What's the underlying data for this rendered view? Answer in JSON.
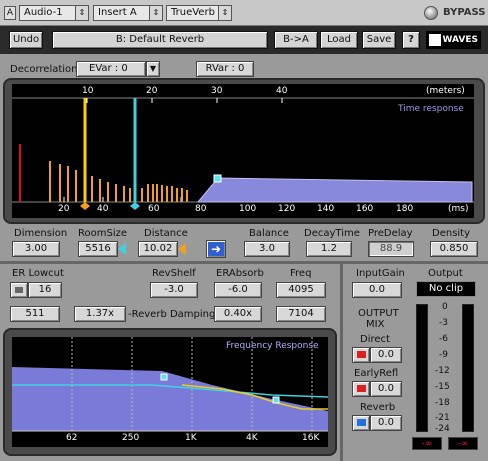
{
  "host": {
    "track": "Audio-1",
    "insert": "Insert A",
    "plugin": "TrueVerb",
    "track_button_letter": "A",
    "bypass_label": "BYPASS"
  },
  "toolbar": {
    "undo": "Undo",
    "preset": "B: Default Reverb",
    "ab": "B->A",
    "load": "Load",
    "save": "Save",
    "help": "?",
    "logo": "WAVES"
  },
  "decorrelation": {
    "label": "Decorrelation",
    "evar": "EVar : 0",
    "rvar": "RVar : 0"
  },
  "time_display": {
    "title": "Time response",
    "top_unit": "(meters)",
    "top_ticks": [
      "10",
      "20",
      "30",
      "40"
    ],
    "bottom_unit": "(ms)",
    "bottom_ticks": [
      "20",
      "40",
      "60",
      "80",
      "100",
      "120",
      "140",
      "160",
      "180"
    ],
    "colors": {
      "direct": "#e01010",
      "early": "#f0a020",
      "cursor": "#ffd000",
      "room": "#40d0e0",
      "tail": "#8888dd"
    }
  },
  "room_params": [
    {
      "label": "Dimension",
      "value": "3.00"
    },
    {
      "label": "RoomSize",
      "value": "5516"
    },
    {
      "label": "Distance",
      "value": "10.02"
    },
    {
      "label": "Balance",
      "value": "3.0"
    },
    {
      "label": "DecayTime",
      "value": "1.2"
    },
    {
      "label": "PreDelay",
      "value": "88.9"
    },
    {
      "label": "Density",
      "value": "0.850"
    }
  ],
  "eq": {
    "er_lowcut_label": "ER Lowcut",
    "er_lowcut_value": "16",
    "revshelf_label": "RevShelf",
    "revshelf_value": "-3.0",
    "erabsorb_label": "ERAbsorb",
    "erabsorb_value": "-6.0",
    "freq_label": "Freq",
    "freq_value": "4095",
    "low_value": "511",
    "damp1_value": "1.37x",
    "damping_label": "-Reverb Damping-",
    "damp2_value": "0.40x",
    "high_value": "7104"
  },
  "freq_display": {
    "title": "Frequency Response",
    "ticks": [
      "62",
      "250",
      "1K",
      "4K",
      "16K"
    ]
  },
  "output": {
    "input_gain_label": "InputGain",
    "input_gain_value": "0.0",
    "output_label": "Output",
    "output_value": "No clip",
    "mix_label_1": "OUTPUT",
    "mix_label_2": "MIX",
    "direct_label": "Direct",
    "direct_value": "0.0",
    "early_label": "EarlyRefl",
    "early_value": "0.0",
    "reverb_label": "Reverb",
    "reverb_value": "0.0",
    "meter_scale": [
      "0",
      "-3",
      "-6",
      "-9",
      "-12",
      "-15",
      "-18",
      "-21",
      "-24"
    ],
    "peak_left": "-∞",
    "peak_right": "-∞"
  }
}
